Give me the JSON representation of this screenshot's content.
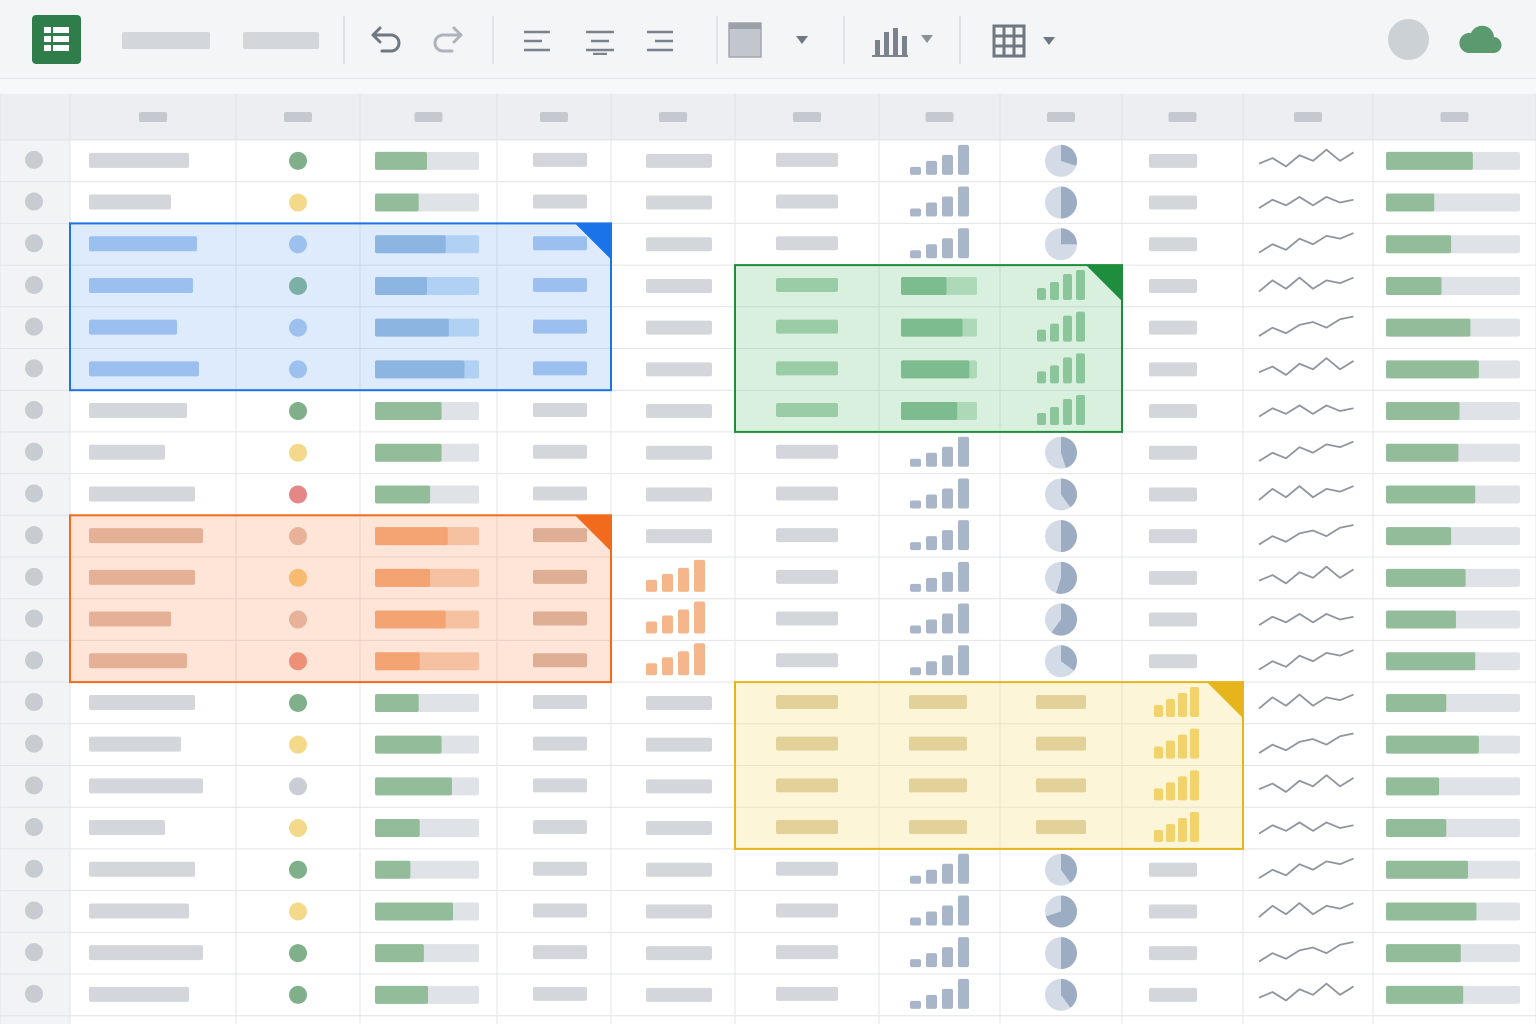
{
  "app": {
    "icons": {
      "app": "spreadsheet-app-icon",
      "undo": "undo-icon",
      "redo": "redo-icon",
      "align_left": "align-left-icon",
      "align_center": "align-center-icon",
      "align_right": "align-right-icon",
      "fill": "fill-color-icon",
      "fill_menu": "chevron-down-icon",
      "chart": "bar-chart-icon",
      "chart_menu": "chevron-down-icon",
      "table": "table-grid-icon",
      "table_menu": "chevron-down-icon",
      "avatar": "user-avatar",
      "cloud": "cloud-sync-icon"
    }
  },
  "colors": {
    "brand": "#2f7d4b",
    "placeholder": "#d3d7dc",
    "grid_line": "#e1e4e8",
    "header_bg": "#eceef1",
    "status_green": "#7fb08a",
    "status_yellow": "#f5d98a",
    "status_red": "#e58787",
    "status_grey": "#c9ced4",
    "progress_green": "#93bd9a",
    "selection_blue": "#1a73e8",
    "selection_green": "#1e8e3e",
    "selection_orange": "#f26b1d",
    "selection_yellow": "#e5b51b"
  },
  "sheet": {
    "row_count": 21,
    "column_count": 12,
    "status": [
      "green",
      "yellow",
      "blue",
      "green",
      "blue",
      "blue",
      "green",
      "yellow",
      "red",
      "grey",
      "yellow",
      "grey",
      "red",
      "green",
      "yellow",
      "grey",
      "yellow",
      "green",
      "yellow",
      "green",
      "green"
    ],
    "progress": [
      0.5,
      0.42,
      0.68,
      0.5,
      0.71,
      0.86,
      0.64,
      0.64,
      0.53,
      0.7,
      0.53,
      0.68,
      0.43,
      0.42,
      0.64,
      0.74,
      0.43,
      0.34,
      0.75,
      0.47,
      0.51
    ],
    "meter": [
      0.72,
      0.4,
      0.54,
      0.46,
      0.7,
      0.77,
      0.61,
      0.6,
      0.74,
      0.54,
      0.66,
      0.58,
      0.74,
      0.5,
      0.77,
      0.44,
      0.5,
      0.68,
      0.75,
      0.62,
      0.64
    ],
    "pie": [
      0.3,
      0.5,
      0.25,
      null,
      null,
      null,
      null,
      0.45,
      0.4,
      0.5,
      0.55,
      0.6,
      0.35,
      null,
      null,
      null,
      null,
      0.4,
      0.7,
      0.5,
      0.4
    ],
    "selections": [
      {
        "color": "blue",
        "rows": [
          2,
          5
        ],
        "cols": [
          1,
          4
        ]
      },
      {
        "color": "green",
        "rows": [
          3,
          6
        ],
        "cols": [
          6,
          8
        ]
      },
      {
        "color": "orange",
        "rows": [
          9,
          12
        ],
        "cols": [
          1,
          4
        ]
      },
      {
        "color": "yellow",
        "rows": [
          13,
          16
        ],
        "cols": [
          6,
          9
        ]
      }
    ]
  }
}
